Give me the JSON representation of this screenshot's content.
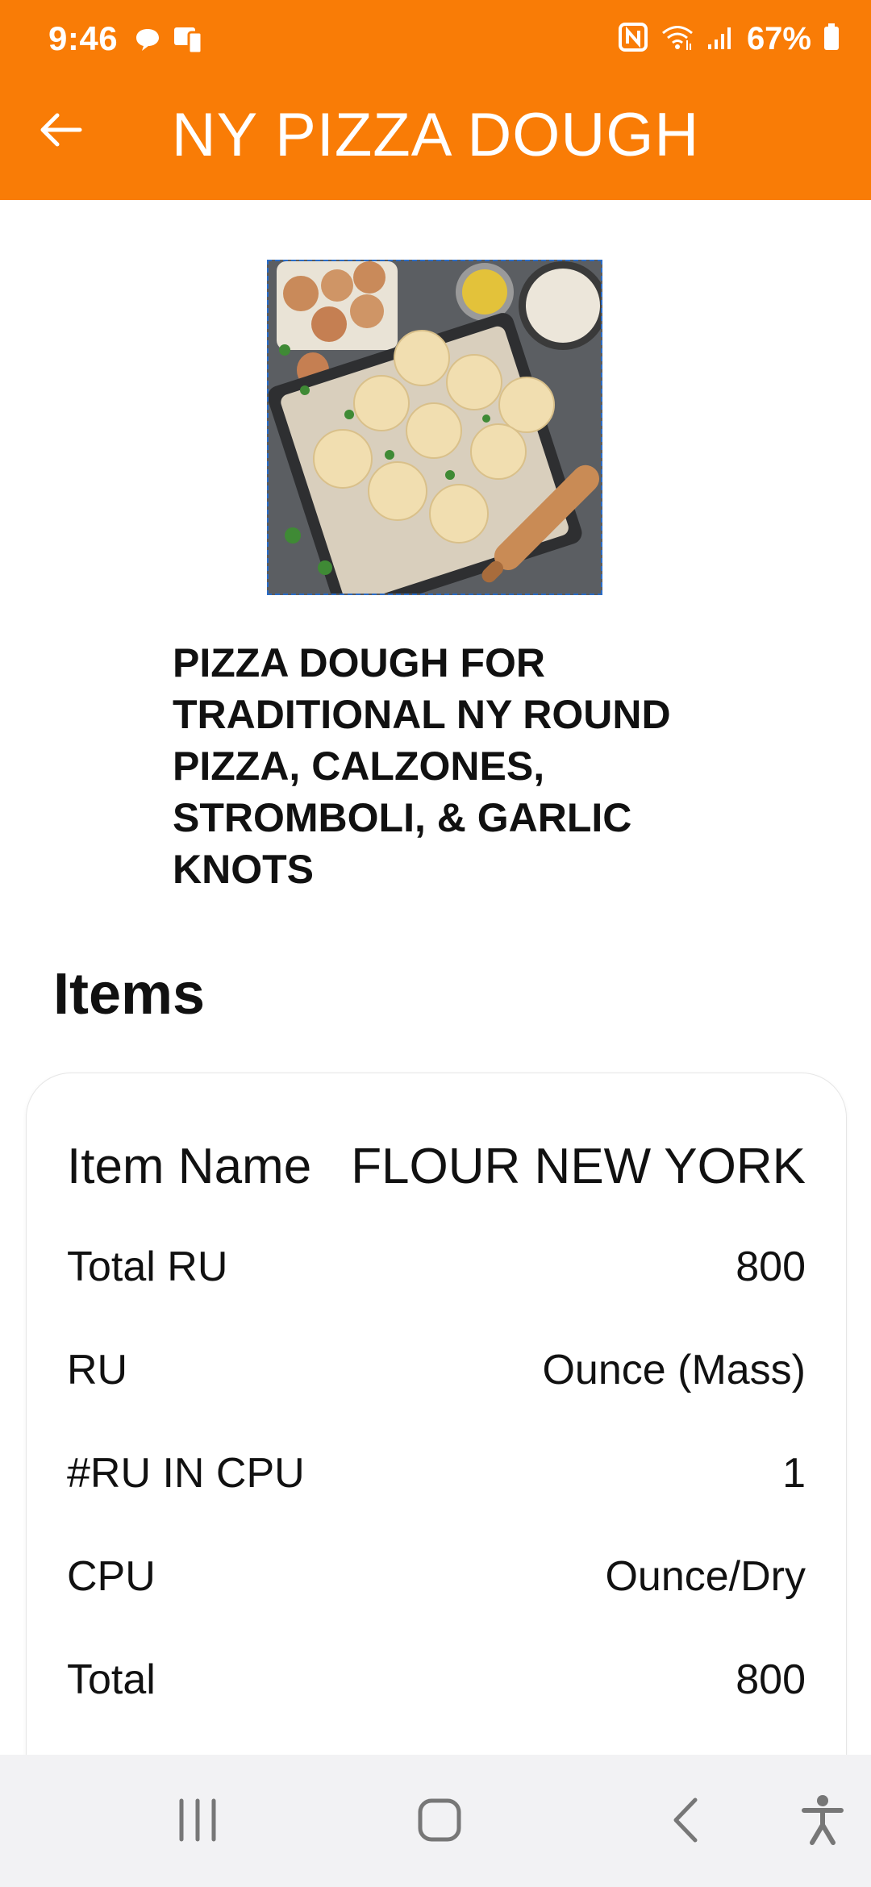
{
  "status_bar": {
    "time": "9:46",
    "battery": "67%",
    "left_icons": [
      "chat-bubble-icon",
      "device-icon"
    ],
    "right_icons": [
      "nfc-icon",
      "wifi-icon",
      "signal-icon",
      "battery-icon"
    ]
  },
  "app_bar": {
    "title": "NY PIZZA DOUGH",
    "back_icon": "back-arrow-icon",
    "color": "#f97c06"
  },
  "recipe": {
    "image_alt": "dough balls on baking tray",
    "description": "PIZZA DOUGH FOR TRADITIONAL NY ROUND PIZZA, CALZONES, STROMBOLI, & GARLIC KNOTS"
  },
  "items_section": {
    "heading": "Items",
    "rows": [
      {
        "label": "Item Name",
        "value": "FLOUR NEW YORK"
      },
      {
        "label": "Total RU",
        "value": "800"
      },
      {
        "label": "RU",
        "value": "Ounce (Mass)"
      },
      {
        "label": "#RU IN CPU",
        "value": "1"
      },
      {
        "label": "CPU",
        "value": "Ounce/Dry"
      },
      {
        "label": "Total",
        "value": "800"
      }
    ]
  },
  "nav_bar": {
    "buttons": [
      "recents-icon",
      "home-icon",
      "back-icon",
      "accessibility-icon"
    ]
  }
}
